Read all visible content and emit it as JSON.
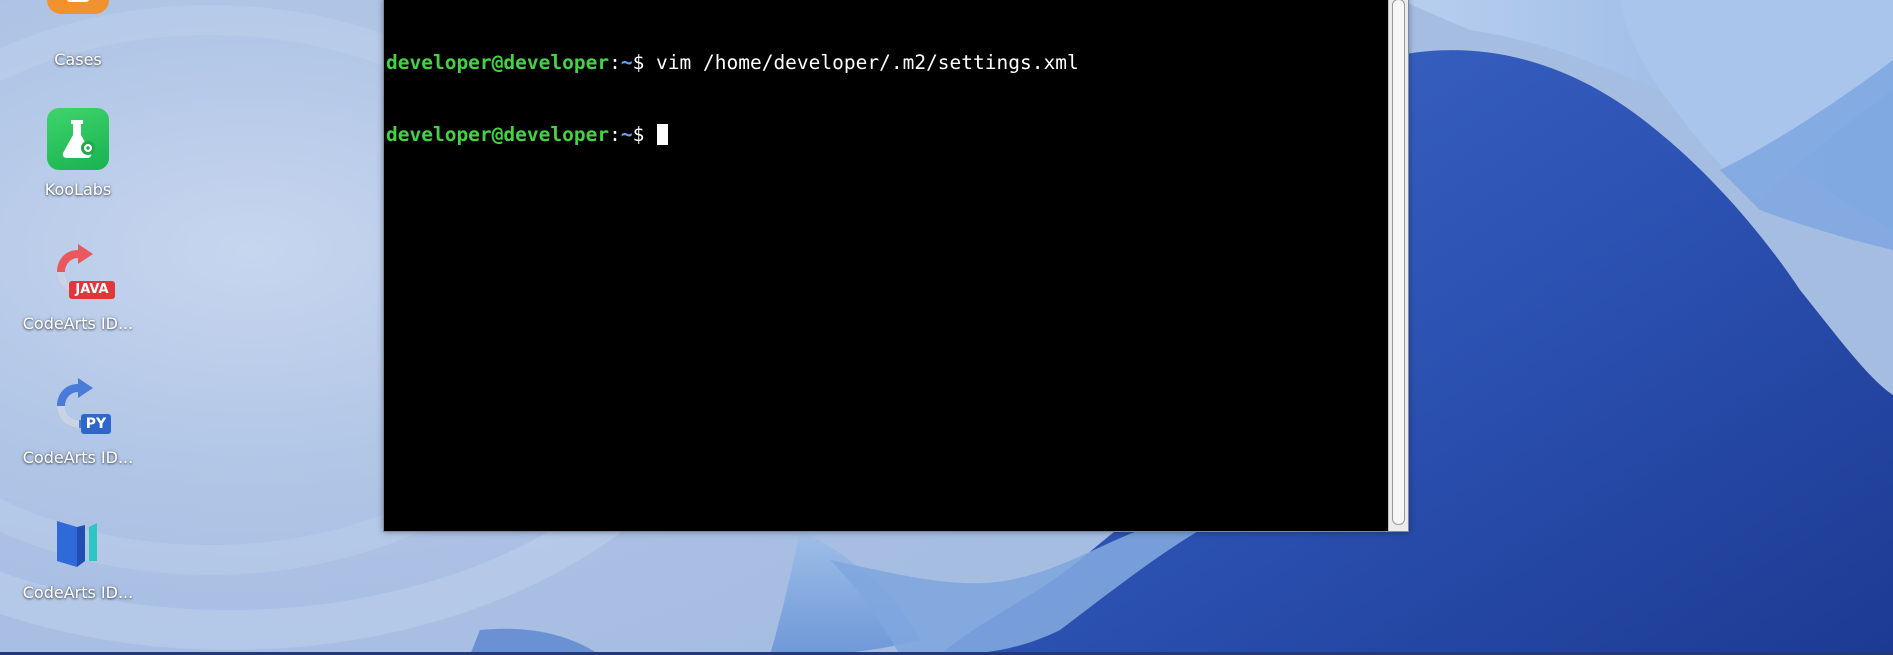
{
  "desktop": {
    "icons": [
      {
        "label": "Cases",
        "icon": "cases-icon"
      },
      {
        "label": "KooLabs",
        "icon": "koolabs-icon"
      },
      {
        "label": "CodeArts ID...",
        "icon": "codearts-java-icon",
        "badge": "JAVA"
      },
      {
        "label": "CodeArts ID...",
        "icon": "codearts-python-icon",
        "badge": "PY"
      },
      {
        "label": "CodeArts ID...",
        "icon": "codearts-one-icon"
      }
    ]
  },
  "terminal": {
    "lines": [
      {
        "user": "developer@developer",
        "sep": ":",
        "path": "~",
        "symbol": "$ ",
        "command": "vim /home/developer/.m2/settings.xml"
      },
      {
        "user": "developer@developer",
        "sep": ":",
        "path": "~",
        "symbol": "$ ",
        "command": ""
      }
    ]
  },
  "colors": {
    "prompt_user": "#44d245",
    "prompt_path": "#5aa7ff",
    "terminal_bg": "#000000"
  }
}
